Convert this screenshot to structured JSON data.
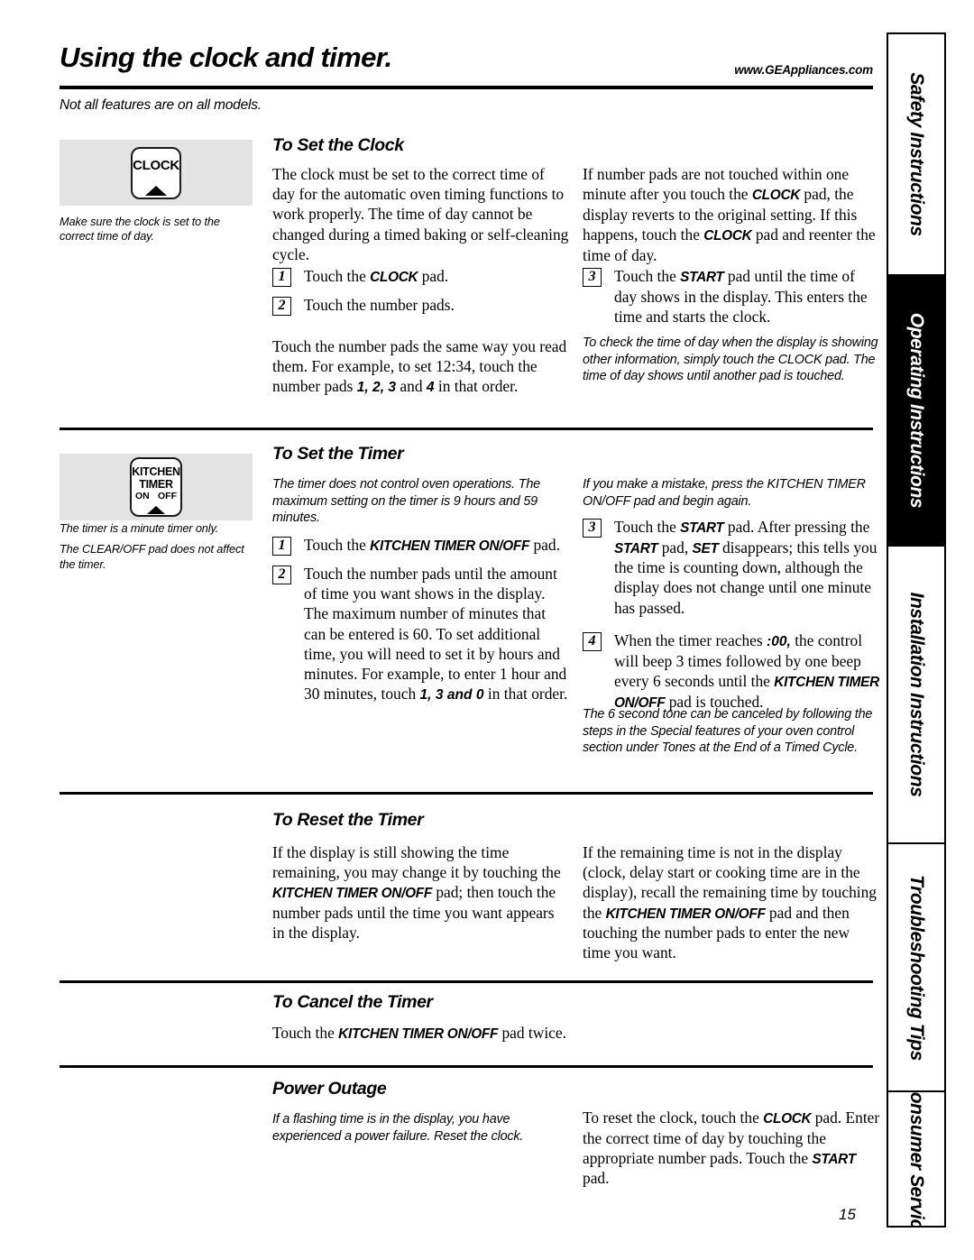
{
  "header": {
    "title": "Using the clock and timer.",
    "url": "www.GEAppliances.com",
    "subtitle": "Not all features are on all models."
  },
  "side_tabs": [
    {
      "label": "Safety Instructions",
      "active": false
    },
    {
      "label": "Operating Instructions",
      "active": true
    },
    {
      "label": "Installation Instructions",
      "active": false
    },
    {
      "label": "Troubleshooting Tips",
      "active": false
    },
    {
      "label": "Consumer Service",
      "active": false
    }
  ],
  "pads": {
    "clock": {
      "line1": "CLOCK",
      "icon": "triangle-up-icon"
    },
    "timer": {
      "line1": "KITCHEN",
      "line2": "TIMER",
      "on": "ON",
      "off": "OFF",
      "icon": "triangle-up-icon"
    }
  },
  "captions": {
    "clock": [
      "Make sure the clock is set to the correct time of day."
    ],
    "timer": [
      "The timer is a minute timer only.",
      "The CLEAR/OFF pad does not affect the timer."
    ]
  },
  "sections": {
    "set_clock": {
      "heading": "To Set the Clock",
      "left_intro": "The clock must be set to the correct time of day for the automatic oven timing functions to work properly. The time of day cannot be changed during a timed baking or self-cleaning cycle.",
      "steps_left": [
        {
          "num": "1",
          "text_pre": "Touch the ",
          "emphasis": "CLOCK",
          "text_post": " pad."
        },
        {
          "num": "2",
          "text_pre": "Touch the number pads.",
          "emphasis": "",
          "text_post": ""
        }
      ],
      "left_example_pre": "Touch the number pads the same way you read them. For example, to set 12:34, touch the number pads ",
      "left_example_nums": "1, 2, 3",
      "left_example_mid": " and ",
      "left_example_nums2": "4",
      "left_example_post": " in that order.",
      "right_intro_a": "If number pads are not touched within one minute after you touch the ",
      "right_intro_b": "CLOCK",
      "right_intro_c": " pad, the display reverts to the original setting. If this happens, touch the ",
      "right_intro_d": "CLOCK",
      "right_intro_e": " pad and reenter the time of day.",
      "step3": {
        "num": "3",
        "pre": "Touch the ",
        "emphasis": "START",
        "post": " pad until the time of day shows in the display. This enters the time and starts the clock."
      },
      "right_note": "To check the time of day when the display is showing other information, simply touch the CLOCK pad. The time of day shows until another pad is touched."
    },
    "set_timer": {
      "heading": "To Set the Timer",
      "left_note": "The timer does not control oven operations. The maximum setting on the timer is 9 hours and 59 minutes.",
      "step1": {
        "num": "1",
        "pre": "Touch the ",
        "emphasis": "KITCHEN TIMER ON/OFF",
        "post": " pad."
      },
      "step2": {
        "num": "2",
        "pre": "Touch the number pads until the amount of time you want shows in the display. The maximum number of minutes that can be entered is 60. To set additional time, you will need to set it by hours and minutes. For example, to enter 1 hour and 30 minutes, touch ",
        "emphasis": "1, 3 and 0",
        "post": " in that order."
      },
      "right_note_top": "If you make a mistake, press the KITCHEN TIMER ON/OFF pad and begin again.",
      "step3": {
        "num": "3",
        "pre": "Touch the ",
        "e1": "START",
        "mid1": " pad. After pressing the ",
        "e2": "START",
        "mid2": " pad, ",
        "e3": "SET",
        "post": " disappears; this tells you the time is counting down, although the display does not change until one minute has passed."
      },
      "step4": {
        "num": "4",
        "pre": "When the timer reaches ",
        "e1": ":00,",
        "mid1": " the control will beep 3 times followed by one beep every 6 seconds until the ",
        "e2": "KITCHEN TIMER ON/OFF",
        "post": " pad is touched."
      },
      "right_note_bottom": "The 6 second tone can be canceled by following the steps in the Special features of your oven control section under Tones at the End of a Timed Cycle."
    },
    "reset_timer": {
      "heading": "To Reset the Timer",
      "left_a": "If the display is still showing the time remaining, you may change it by touching the ",
      "left_emphasis": "KITCHEN TIMER ON/OFF",
      "left_b": " pad; then touch the number pads until the time you want appears in the display.",
      "right_a": "If the remaining time is not in the display (clock, delay start or cooking time are in the display), recall the remaining time by touching the ",
      "right_emphasis": "KITCHEN TIMER ON/OFF",
      "right_b": " pad and then touching the number pads to enter the new time you want."
    },
    "cancel_timer": {
      "heading": "To Cancel the Timer",
      "text_pre": "Touch the ",
      "emphasis": "KITCHEN TIMER ON/OFF",
      "text_post": " pad twice."
    },
    "power_outage": {
      "heading": "Power Outage",
      "left_note": "If a flashing time is in the display, you have experienced a power failure. Reset the clock.",
      "right_a": "To reset the clock, touch the ",
      "right_e1": "CLOCK",
      "right_b": " pad. Enter the correct time of day by touching the appropriate number pads. Touch the ",
      "right_e2": "START",
      "right_c": " pad."
    }
  },
  "page_number": "15"
}
